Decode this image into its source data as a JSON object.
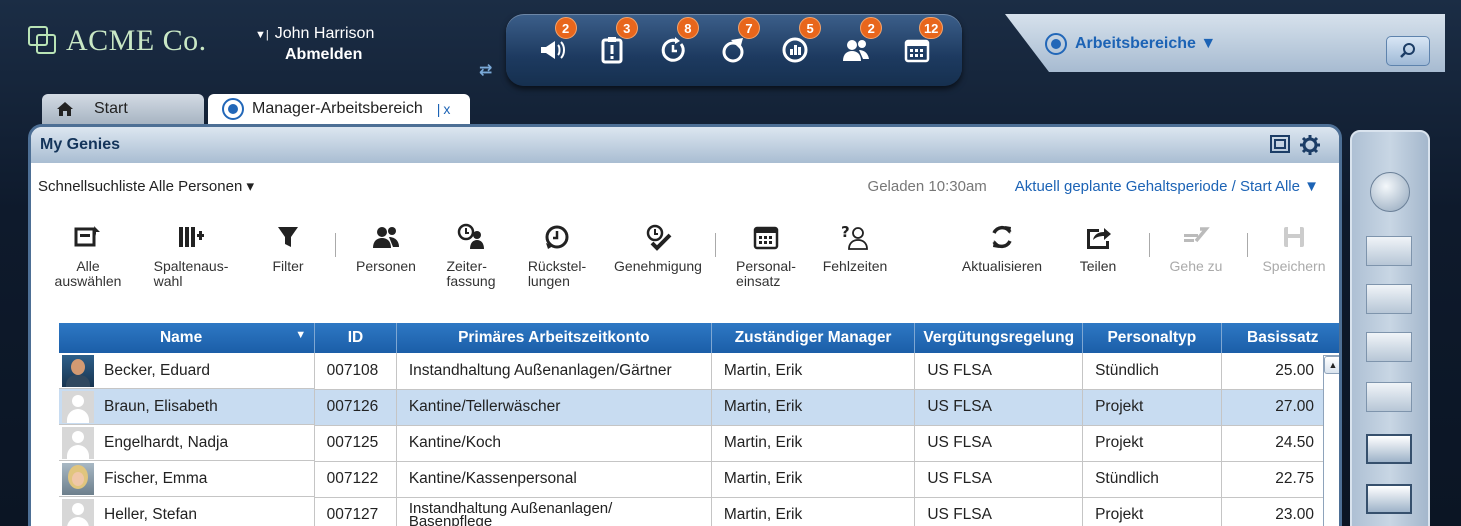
{
  "header": {
    "brand": "ACME Co.",
    "user_name": "John Harrison",
    "user_caret": "▼|",
    "logout_label": "Abmelden"
  },
  "nav_badges": {
    "announcements": "2",
    "timecard": "3",
    "refresh_period": "8",
    "routes": "7",
    "reports": "5",
    "team": "2",
    "calendar": "12"
  },
  "workspaces": {
    "label": "Arbeitsbereiche ▼"
  },
  "tabs": [
    {
      "label": "Start"
    },
    {
      "label": "Manager-Arbeitsbereich",
      "close": "x"
    }
  ],
  "panel": {
    "title": "My Genies",
    "quick_list": "Schnellsuchliste Alle Personen ▾",
    "loaded": "Geladen 10:30am",
    "period": "Aktuell geplante Gehaltsperiode / Start Alle ▼"
  },
  "toolbar": {
    "select_all": "Alle\nauswählen",
    "columns": "Spaltenaus-\nwahl",
    "filter": "Filter",
    "people": "Personen",
    "timekeeping": "Zeiter-\nfassung",
    "reversals": "Rückstel-\nlungen",
    "approval": "Genehmigung",
    "staffing": "Personal-\neinsatz",
    "absences": "Fehlzeiten",
    "refresh": "Aktualisieren",
    "share": "Teilen",
    "goto": "Gehe zu",
    "save": "Speichern"
  },
  "table": {
    "columns": [
      "Name",
      "ID",
      "Primäres Arbeitszeitkonto",
      "Zuständiger Manager",
      "Vergütungsregelung",
      "Personaltyp",
      "Basissatz"
    ],
    "rows": [
      {
        "name": "Becker, Eduard",
        "id": "007108",
        "account": "Instandhaltung Außenanlagen/Gärtner",
        "manager": "Martin, Erik",
        "pay_rule": "US FLSA",
        "type": "Stündlich",
        "rate": "25.00"
      },
      {
        "name": "Braun, Elisabeth",
        "id": "007126",
        "account": "Kantine/Tellerwäscher",
        "manager": "Martin, Erik",
        "pay_rule": "US FLSA",
        "type": "Projekt",
        "rate": "27.00"
      },
      {
        "name": "Engelhardt, Nadja",
        "id": "007125",
        "account": "Kantine/Koch",
        "manager": "Martin, Erik",
        "pay_rule": "US FLSA",
        "type": "Projekt",
        "rate": "24.50"
      },
      {
        "name": "Fischer, Emma",
        "id": "007122",
        "account": "Kantine/Kassenpersonal",
        "manager": "Martin, Erik",
        "pay_rule": "US FLSA",
        "type": "Stündlich",
        "rate": "22.75"
      },
      {
        "name": "Heller, Stefan",
        "id": "007127",
        "account": "Instandhaltung Außenanlagen/\nBasenpflege",
        "manager": "Martin, Erik",
        "pay_rule": "US FLSA",
        "type": "Projekt",
        "rate": "23.00"
      }
    ]
  }
}
